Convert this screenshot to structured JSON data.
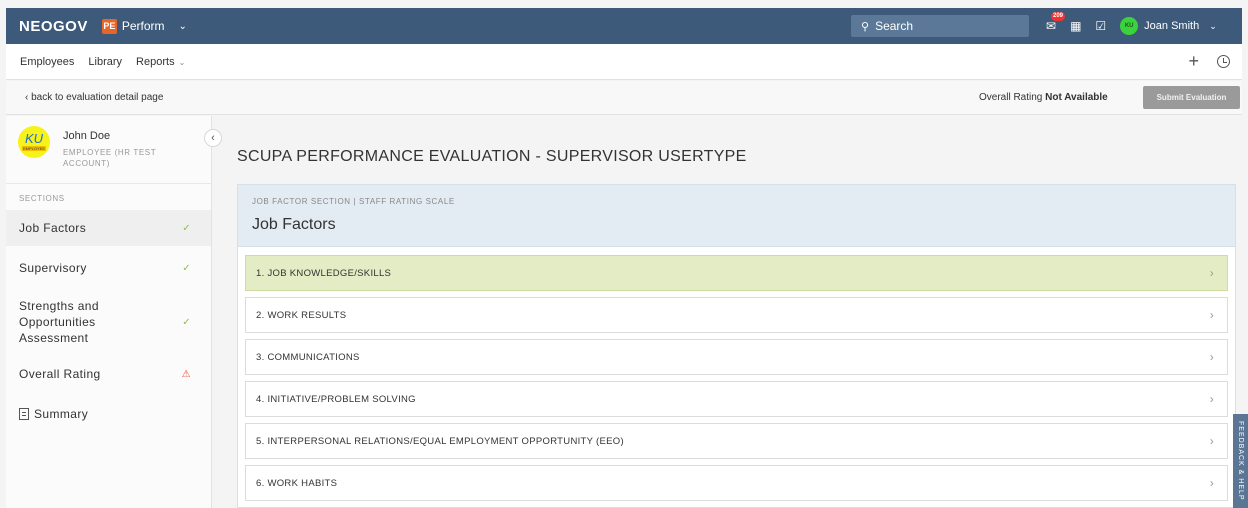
{
  "header": {
    "brand": "NEOGOV",
    "product_badge": "PE",
    "product": "Perform",
    "search_placeholder": "Search",
    "notification_count": "209",
    "user_initials": "KU",
    "user_name": "Joan Smith"
  },
  "nav": {
    "items": [
      "Employees",
      "Library",
      "Reports"
    ]
  },
  "backbar": {
    "back_link": "back to evaluation detail page",
    "overall_rating_label": "Overall Rating",
    "overall_rating_value": "Not Available",
    "submit_label": "Submit Evaluation"
  },
  "employee": {
    "avatar_initials": "KU",
    "avatar_sub": "EMPLOYEE",
    "name": "John Doe",
    "role": "EMPLOYEE (HR TEST ACCOUNT)"
  },
  "sidebar": {
    "sections_label": "SECTIONS",
    "items": [
      {
        "label": "Job Factors",
        "status": "complete"
      },
      {
        "label": "Supervisory",
        "status": "complete"
      },
      {
        "label": "Strengths and Opportunities Assessment",
        "status": "complete"
      },
      {
        "label": "Overall Rating",
        "status": "warning"
      },
      {
        "label": "Summary",
        "status": "none"
      }
    ]
  },
  "main": {
    "title": "SCUPA PERFORMANCE EVALUATION - SUPERVISOR USERTYPE",
    "section_subtitle": "JOB FACTOR SECTION | STAFF RATING SCALE",
    "section_title": "Job Factors",
    "factors": [
      "1. JOB KNOWLEDGE/SKILLS",
      "2. WORK RESULTS",
      "3. COMMUNICATIONS",
      "4. INITIATIVE/PROBLEM SOLVING",
      "5. INTERPERSONAL RELATIONS/EQUAL EMPLOYMENT OPPORTUNITY (EEO)",
      "6. WORK HABITS"
    ]
  },
  "feedback_tab": "FEEDBACK & HELP",
  "colors": {
    "topbar": "#3d5a7a",
    "highlight_row": "#e3ecc4",
    "panel_header": "#e4ecf3",
    "check": "#8fbf4a",
    "warning": "#e05040"
  }
}
